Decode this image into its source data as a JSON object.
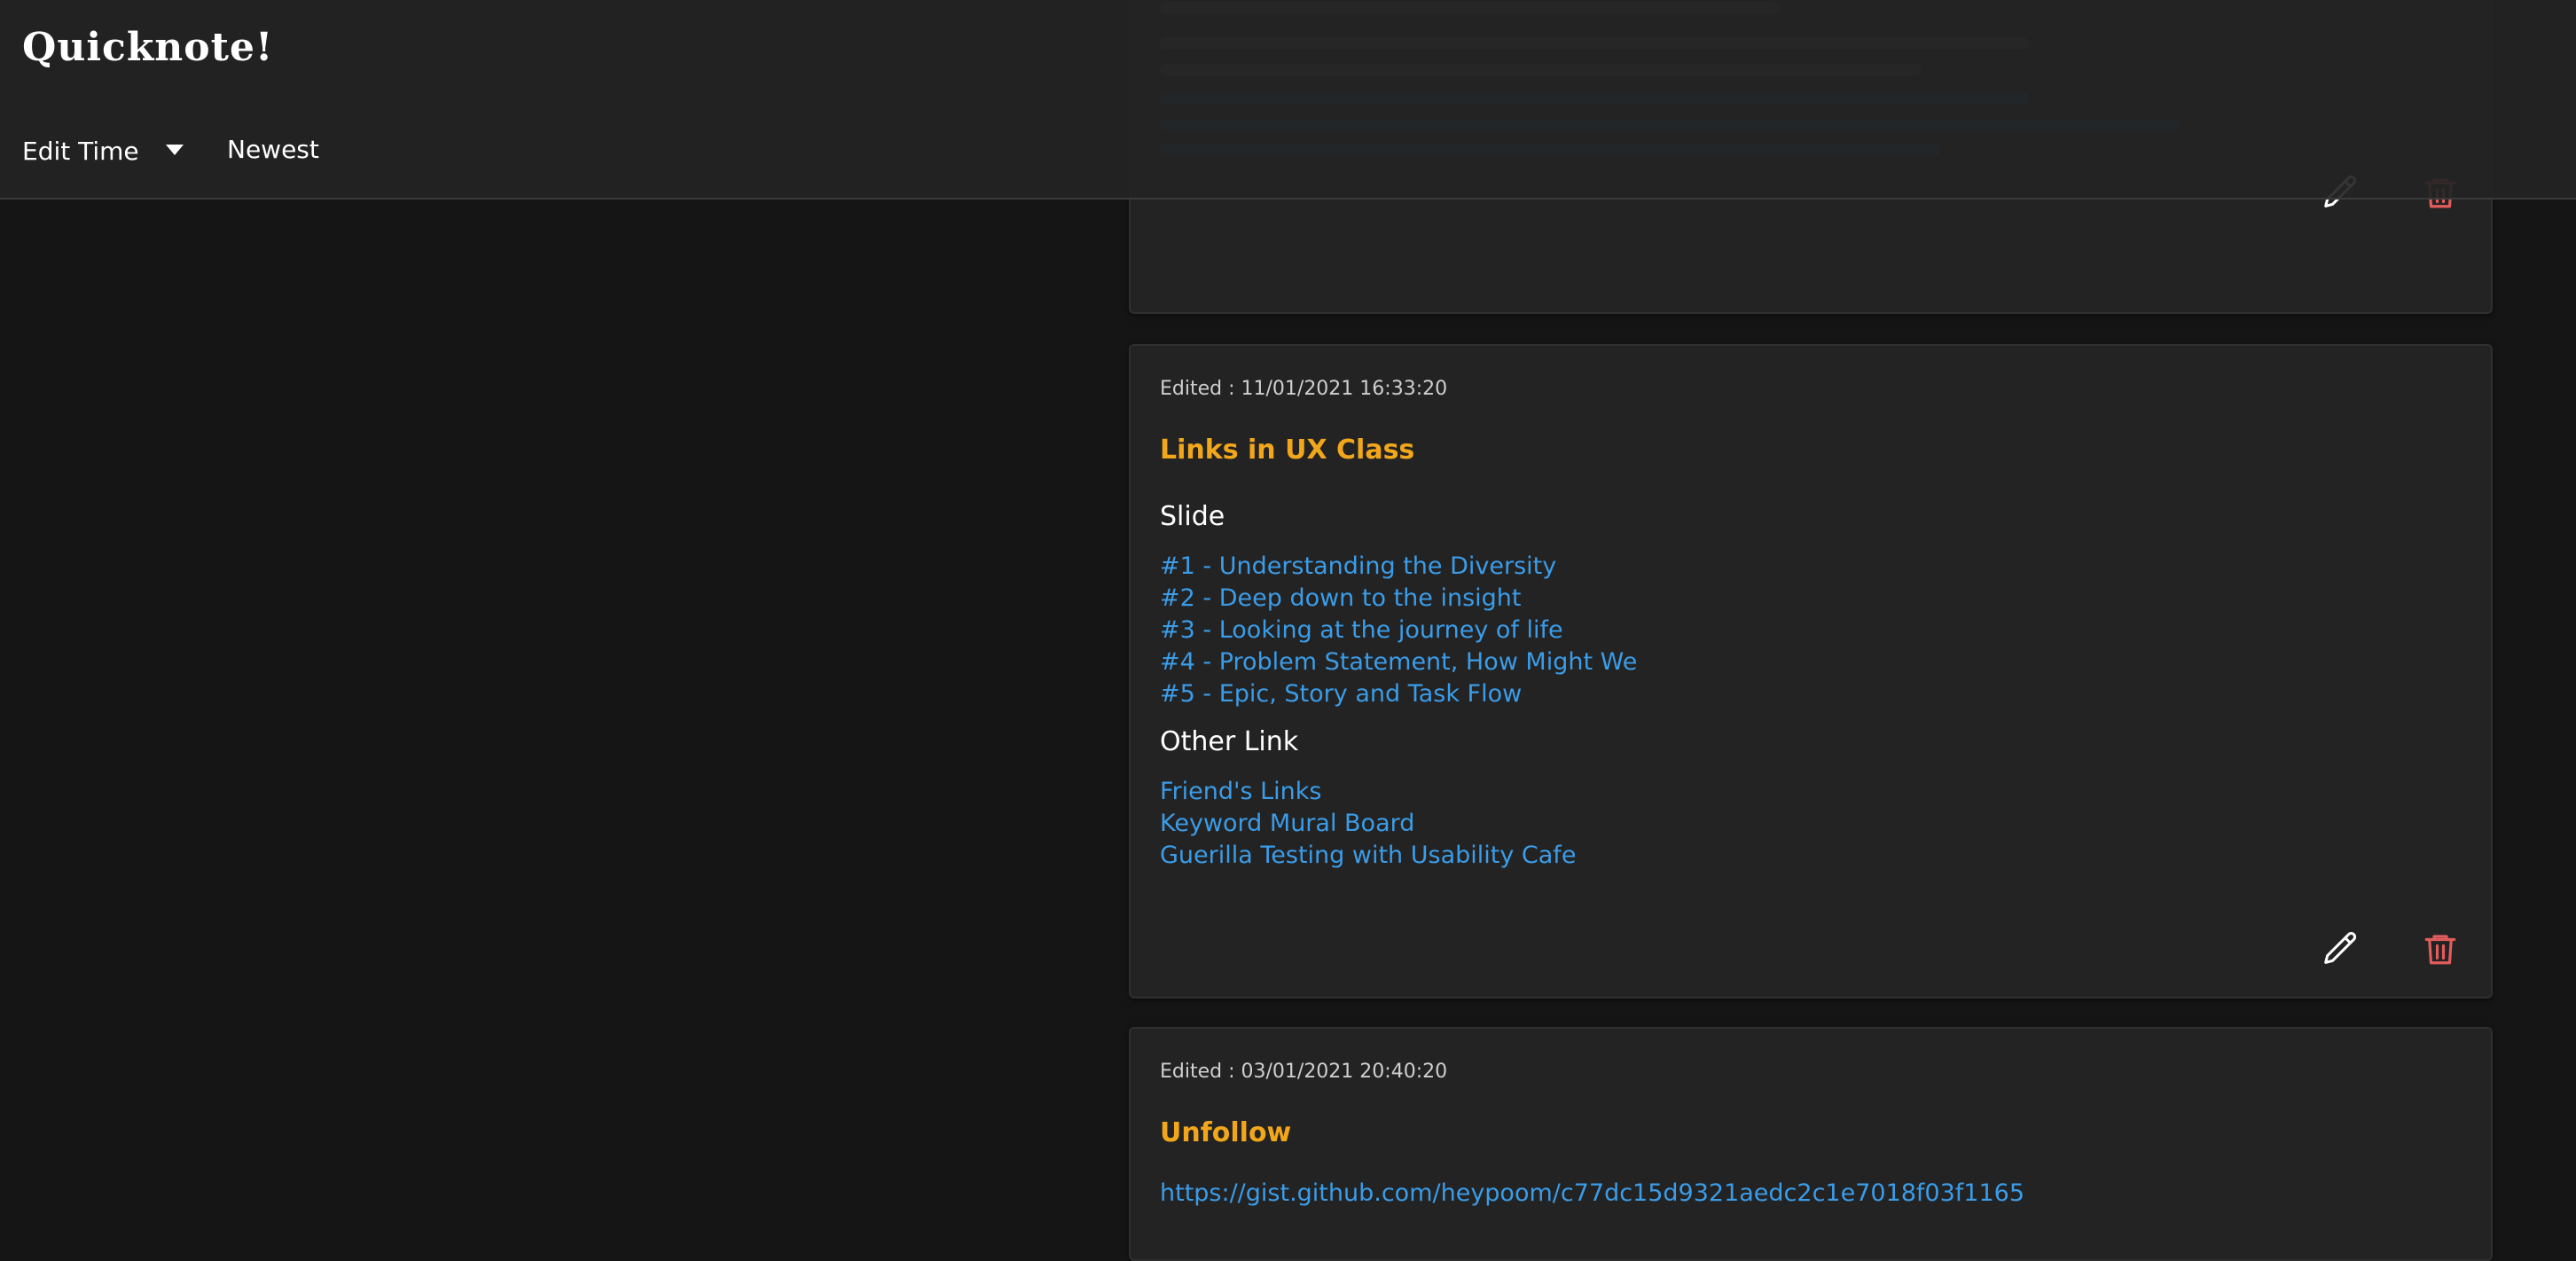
{
  "header": {
    "app_title": "Quicknote!",
    "sort_field_label": "Edit Time",
    "sort_order_label": "Newest"
  },
  "notes": [
    {
      "edited": "",
      "title": ""
    },
    {
      "edited": "Edited : 11/01/2021 16:33:20",
      "title": "Links in UX Class",
      "sections": [
        {
          "heading": "Slide",
          "links": [
            "#1 - Understanding the Diversity",
            "#2 - Deep down to the insight",
            "#3 - Looking at the journey of life",
            "#4 - Problem Statement, How Might We",
            "#5 - Epic, Story and Task Flow"
          ]
        },
        {
          "heading": "Other Link",
          "links": [
            "Friend's Links",
            "Keyword Mural Board",
            "Guerilla Testing with Usability Cafe"
          ]
        }
      ]
    },
    {
      "edited": "Edited : 03/01/2021 20:40:20",
      "title": "Unfollow",
      "link": "https://gist.github.com/heypoom/c77dc15d9321aedc2c1e7018f03f1165"
    }
  ],
  "icons": {
    "edit": "pencil-icon",
    "delete": "trash-icon"
  },
  "colors": {
    "background": "#151515",
    "card": "#232323",
    "title": "#f2a71b",
    "link": "#3b9ce8",
    "delete": "#e25c5c"
  }
}
